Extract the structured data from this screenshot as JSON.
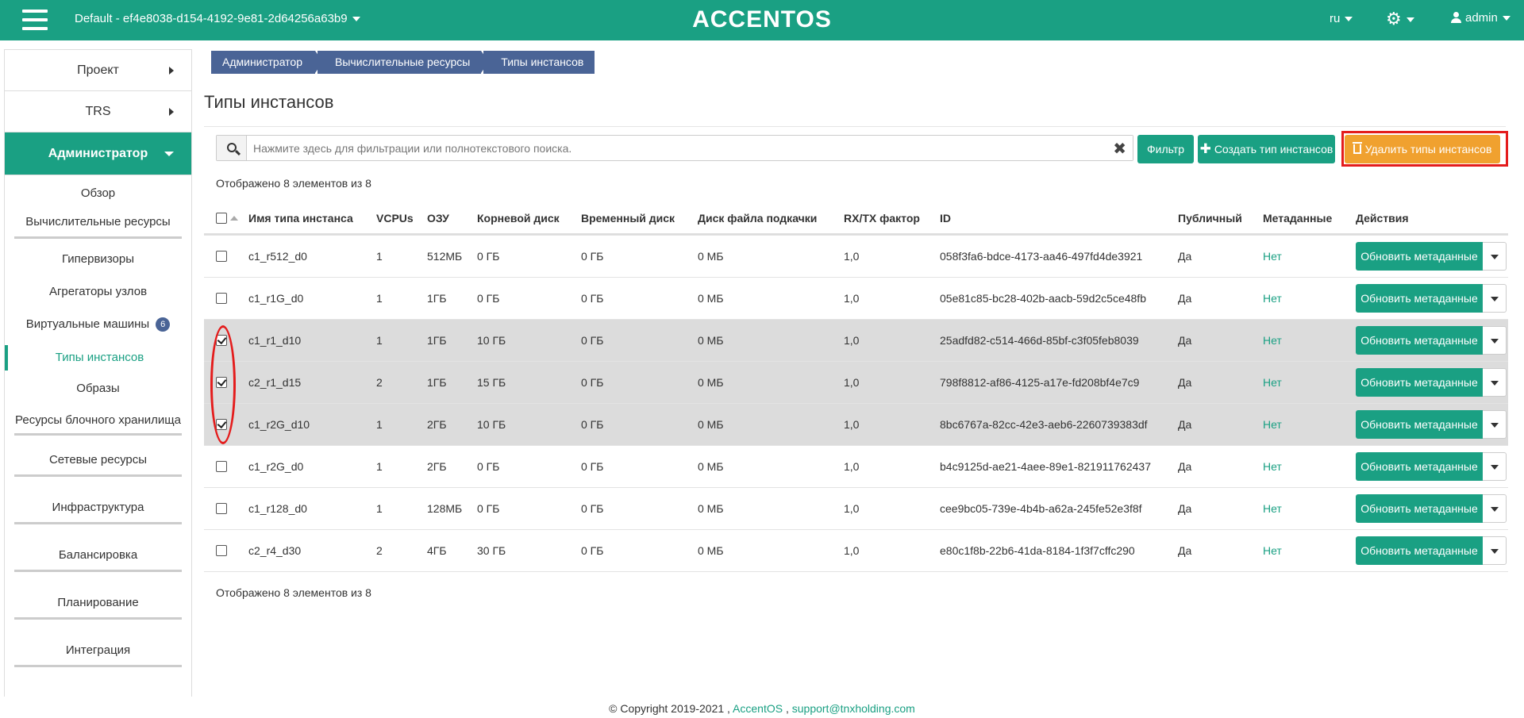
{
  "topbar": {
    "project": "Default - ef4e8038-d154-4192-9e81-2d64256a63b9",
    "logo": "ACCENTOS",
    "lang": "ru",
    "user": "admin"
  },
  "sidebar": {
    "project": "Проект",
    "trs": "TRS",
    "admin": "Администратор",
    "items": {
      "overview": "Обзор",
      "compute": "Вычислительные ресурсы",
      "hypervisors": "Гипервизоры",
      "aggregates": "Агрегаторы узлов",
      "vms": "Виртуальные машины",
      "vms_badge": "6",
      "flavors": "Типы инстансов",
      "images": "Образы",
      "block": "Ресурсы блочного хранилища",
      "network": "Сетевые ресурсы",
      "infra": "Инфраструктура",
      "balancing": "Балансировка",
      "planning": "Планирование",
      "integration": "Интеграция"
    }
  },
  "breadcrumb": [
    "Администратор",
    "Вычислительные ресурсы",
    "Типы инстансов"
  ],
  "page_title": "Типы инстансов",
  "search": {
    "placeholder": "Нажмите здесь для фильтрации или полнотекстового поиска."
  },
  "buttons": {
    "filter": "Фильтр",
    "create": "Создать тип инстансов",
    "delete": "Удалить типы инстансов"
  },
  "count_text": "Отображено 8 элементов из 8",
  "table": {
    "columns": [
      "Имя типа инстанса",
      "VCPUs",
      "ОЗУ",
      "Корневой диск",
      "Временный диск",
      "Диск файла подкачки",
      "RX/TX фактор",
      "ID",
      "Публичный",
      "Метаданные",
      "Действия"
    ],
    "action_label": "Обновить метаданные",
    "rows": [
      {
        "name": "c1_r512_d0",
        "vcpus": "1",
        "ram": "512МБ",
        "root": "0 ГБ",
        "eph": "0 ГБ",
        "swap": "0 МБ",
        "rxtx": "1,0",
        "id": "058f3fa6-bdce-4173-aa46-497fd4de3921",
        "public": "Да",
        "meta": "Нет",
        "checked": false
      },
      {
        "name": "c1_r1G_d0",
        "vcpus": "1",
        "ram": "1ГБ",
        "root": "0 ГБ",
        "eph": "0 ГБ",
        "swap": "0 МБ",
        "rxtx": "1,0",
        "id": "05e81c85-bc28-402b-aacb-59d2c5ce48fb",
        "public": "Да",
        "meta": "Нет",
        "checked": false
      },
      {
        "name": "c1_r1_d10",
        "vcpus": "1",
        "ram": "1ГБ",
        "root": "10 ГБ",
        "eph": "0 ГБ",
        "swap": "0 МБ",
        "rxtx": "1,0",
        "id": "25adfd82-c514-466d-85bf-c3f05feb8039",
        "public": "Да",
        "meta": "Нет",
        "checked": true
      },
      {
        "name": "c2_r1_d15",
        "vcpus": "2",
        "ram": "1ГБ",
        "root": "15 ГБ",
        "eph": "0 ГБ",
        "swap": "0 МБ",
        "rxtx": "1,0",
        "id": "798f8812-af86-4125-a17e-fd208bf4e7c9",
        "public": "Да",
        "meta": "Нет",
        "checked": true
      },
      {
        "name": "c1_r2G_d10",
        "vcpus": "1",
        "ram": "2ГБ",
        "root": "10 ГБ",
        "eph": "0 ГБ",
        "swap": "0 МБ",
        "rxtx": "1,0",
        "id": "8bc6767a-82cc-42e3-aeb6-2260739383df",
        "public": "Да",
        "meta": "Нет",
        "checked": true
      },
      {
        "name": "c1_r2G_d0",
        "vcpus": "1",
        "ram": "2ГБ",
        "root": "0 ГБ",
        "eph": "0 ГБ",
        "swap": "0 МБ",
        "rxtx": "1,0",
        "id": "b4c9125d-ae21-4aee-89e1-821911762437",
        "public": "Да",
        "meta": "Нет",
        "checked": false
      },
      {
        "name": "c1_r128_d0",
        "vcpus": "1",
        "ram": "128МБ",
        "root": "0 ГБ",
        "eph": "0 ГБ",
        "swap": "0 МБ",
        "rxtx": "1,0",
        "id": "cee9bc05-739e-4b4b-a62a-245fe52e3f8f",
        "public": "Да",
        "meta": "Нет",
        "checked": false
      },
      {
        "name": "c2_r4_d30",
        "vcpus": "2",
        "ram": "4ГБ",
        "root": "30 ГБ",
        "eph": "0 ГБ",
        "swap": "0 МБ",
        "rxtx": "1,0",
        "id": "e80c1f8b-22b6-41da-8184-1f3f7cffc290",
        "public": "Да",
        "meta": "Нет",
        "checked": false
      }
    ]
  },
  "footer": {
    "copyright": "© Copyright 2019-2021 ,",
    "brand": "AccentOS",
    "sep": ",",
    "email": "support@tnxholding.com"
  },
  "colors": {
    "accent": "#1aa083",
    "breadcrumb": "#4a6496",
    "delete": "#f0a12f",
    "highlight": "#e41c1c"
  }
}
